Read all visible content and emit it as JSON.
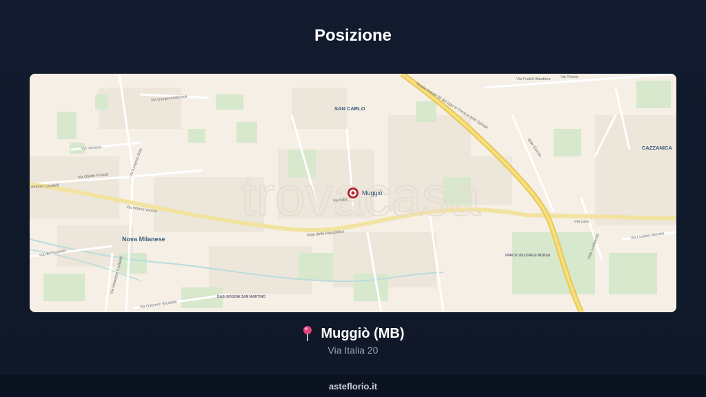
{
  "header": {
    "title": "Posizione"
  },
  "map": {
    "watermark": "trovacasa",
    "marker_label": "Muggiò",
    "district_labels": {
      "san_carlo": "SAN CARLO",
      "cazzanica": "CAZZANICA",
      "nova_milanese": "Nova Milanese",
      "parco": "PARCO VILLORESI MONZA",
      "san_martino": "DASI BOGGIA SAN MARTINO"
    },
    "street_labels": {
      "giorgio_ambrosoli": "Via Giorgio Ambrosoli",
      "venezia": "Via Venezia",
      "armando_diaz": "Via Armando Diaz",
      "olindo_fossati": "Via Olindo Fossati",
      "locatelli": "Antonio Locatelli",
      "vittorio_veneto": "Via Vittorio Veneto",
      "repubblica": "Viale della Repubblica",
      "garibaldi": "Via Giuseppe Garibaldi",
      "assunta": "Via dell'Assunta",
      "brodolini": "Via Giacomo Brodolini",
      "statale_como": "Strada Statale 36 del lago di Como e dello Spluga",
      "via_lario": "Via Lario",
      "viale_elvezia": "Viale Elvezia",
      "lombardia": "Viale Lombardia",
      "luciano_manara": "Via Luciano Manara",
      "franchi_bandiera": "Via Fratelli Bandiera",
      "trieste": "Via Trieste",
      "italia": "Via Italia"
    }
  },
  "location": {
    "name": "Muggiò (MB)",
    "address": "Via Italia 20",
    "pin_icon": "map-pin-icon",
    "pin_color": "#e0457b"
  },
  "footer": {
    "brand": "asteflorio.it"
  }
}
